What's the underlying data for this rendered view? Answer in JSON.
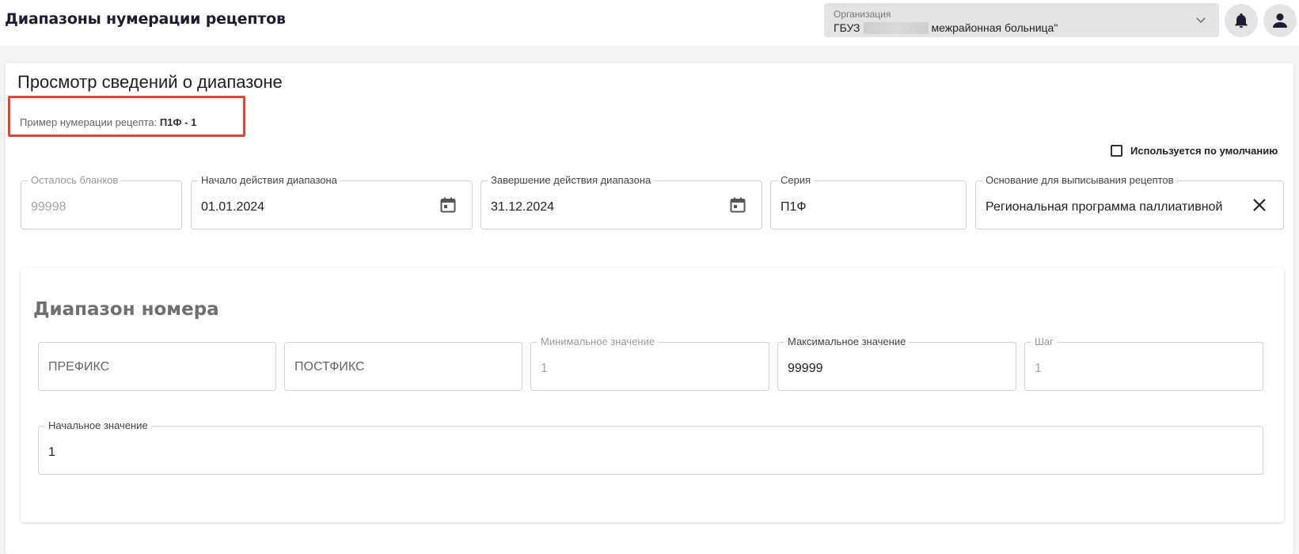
{
  "header": {
    "title": "Диапазоны нумерации рецептов",
    "organization": {
      "label": "Организация",
      "value_prefix": "ГБУЗ",
      "value_suffix": "межрайонная больница\""
    }
  },
  "view": {
    "title": "Просмотр сведений о диапазоне",
    "example_label": "Пример нумерации рецепта:",
    "example_value": "П1Ф - 1",
    "default_checkbox_label": "Используется по умолчанию",
    "fields": {
      "remaining": {
        "label": "Осталось бланков",
        "value": "99998"
      },
      "start": {
        "label": "Начало действия диапазона",
        "value": "01.01.2024"
      },
      "end": {
        "label": "Завершение действия диапазона",
        "value": "31.12.2024"
      },
      "series": {
        "label": "Серия",
        "value": "П1Ф"
      },
      "basis": {
        "label": "Основание для выписывания рецептов",
        "value": "Региональная программа паллиативной"
      }
    }
  },
  "number_range": {
    "title": "Диапазон номера",
    "prefix_placeholder": "ПРЕФИКС",
    "postfix_placeholder": "ПОСТФИКС",
    "min": {
      "label": "Минимальное значение",
      "value": "1"
    },
    "max": {
      "label": "Максимальное значение",
      "value": "99999"
    },
    "step": {
      "label": "Шаг",
      "value": "1"
    },
    "initial": {
      "label": "Начальное значение",
      "value": "1"
    }
  },
  "colors": {
    "highlight_border": "#d9483b",
    "disabled_text": "#a5a5a5"
  }
}
